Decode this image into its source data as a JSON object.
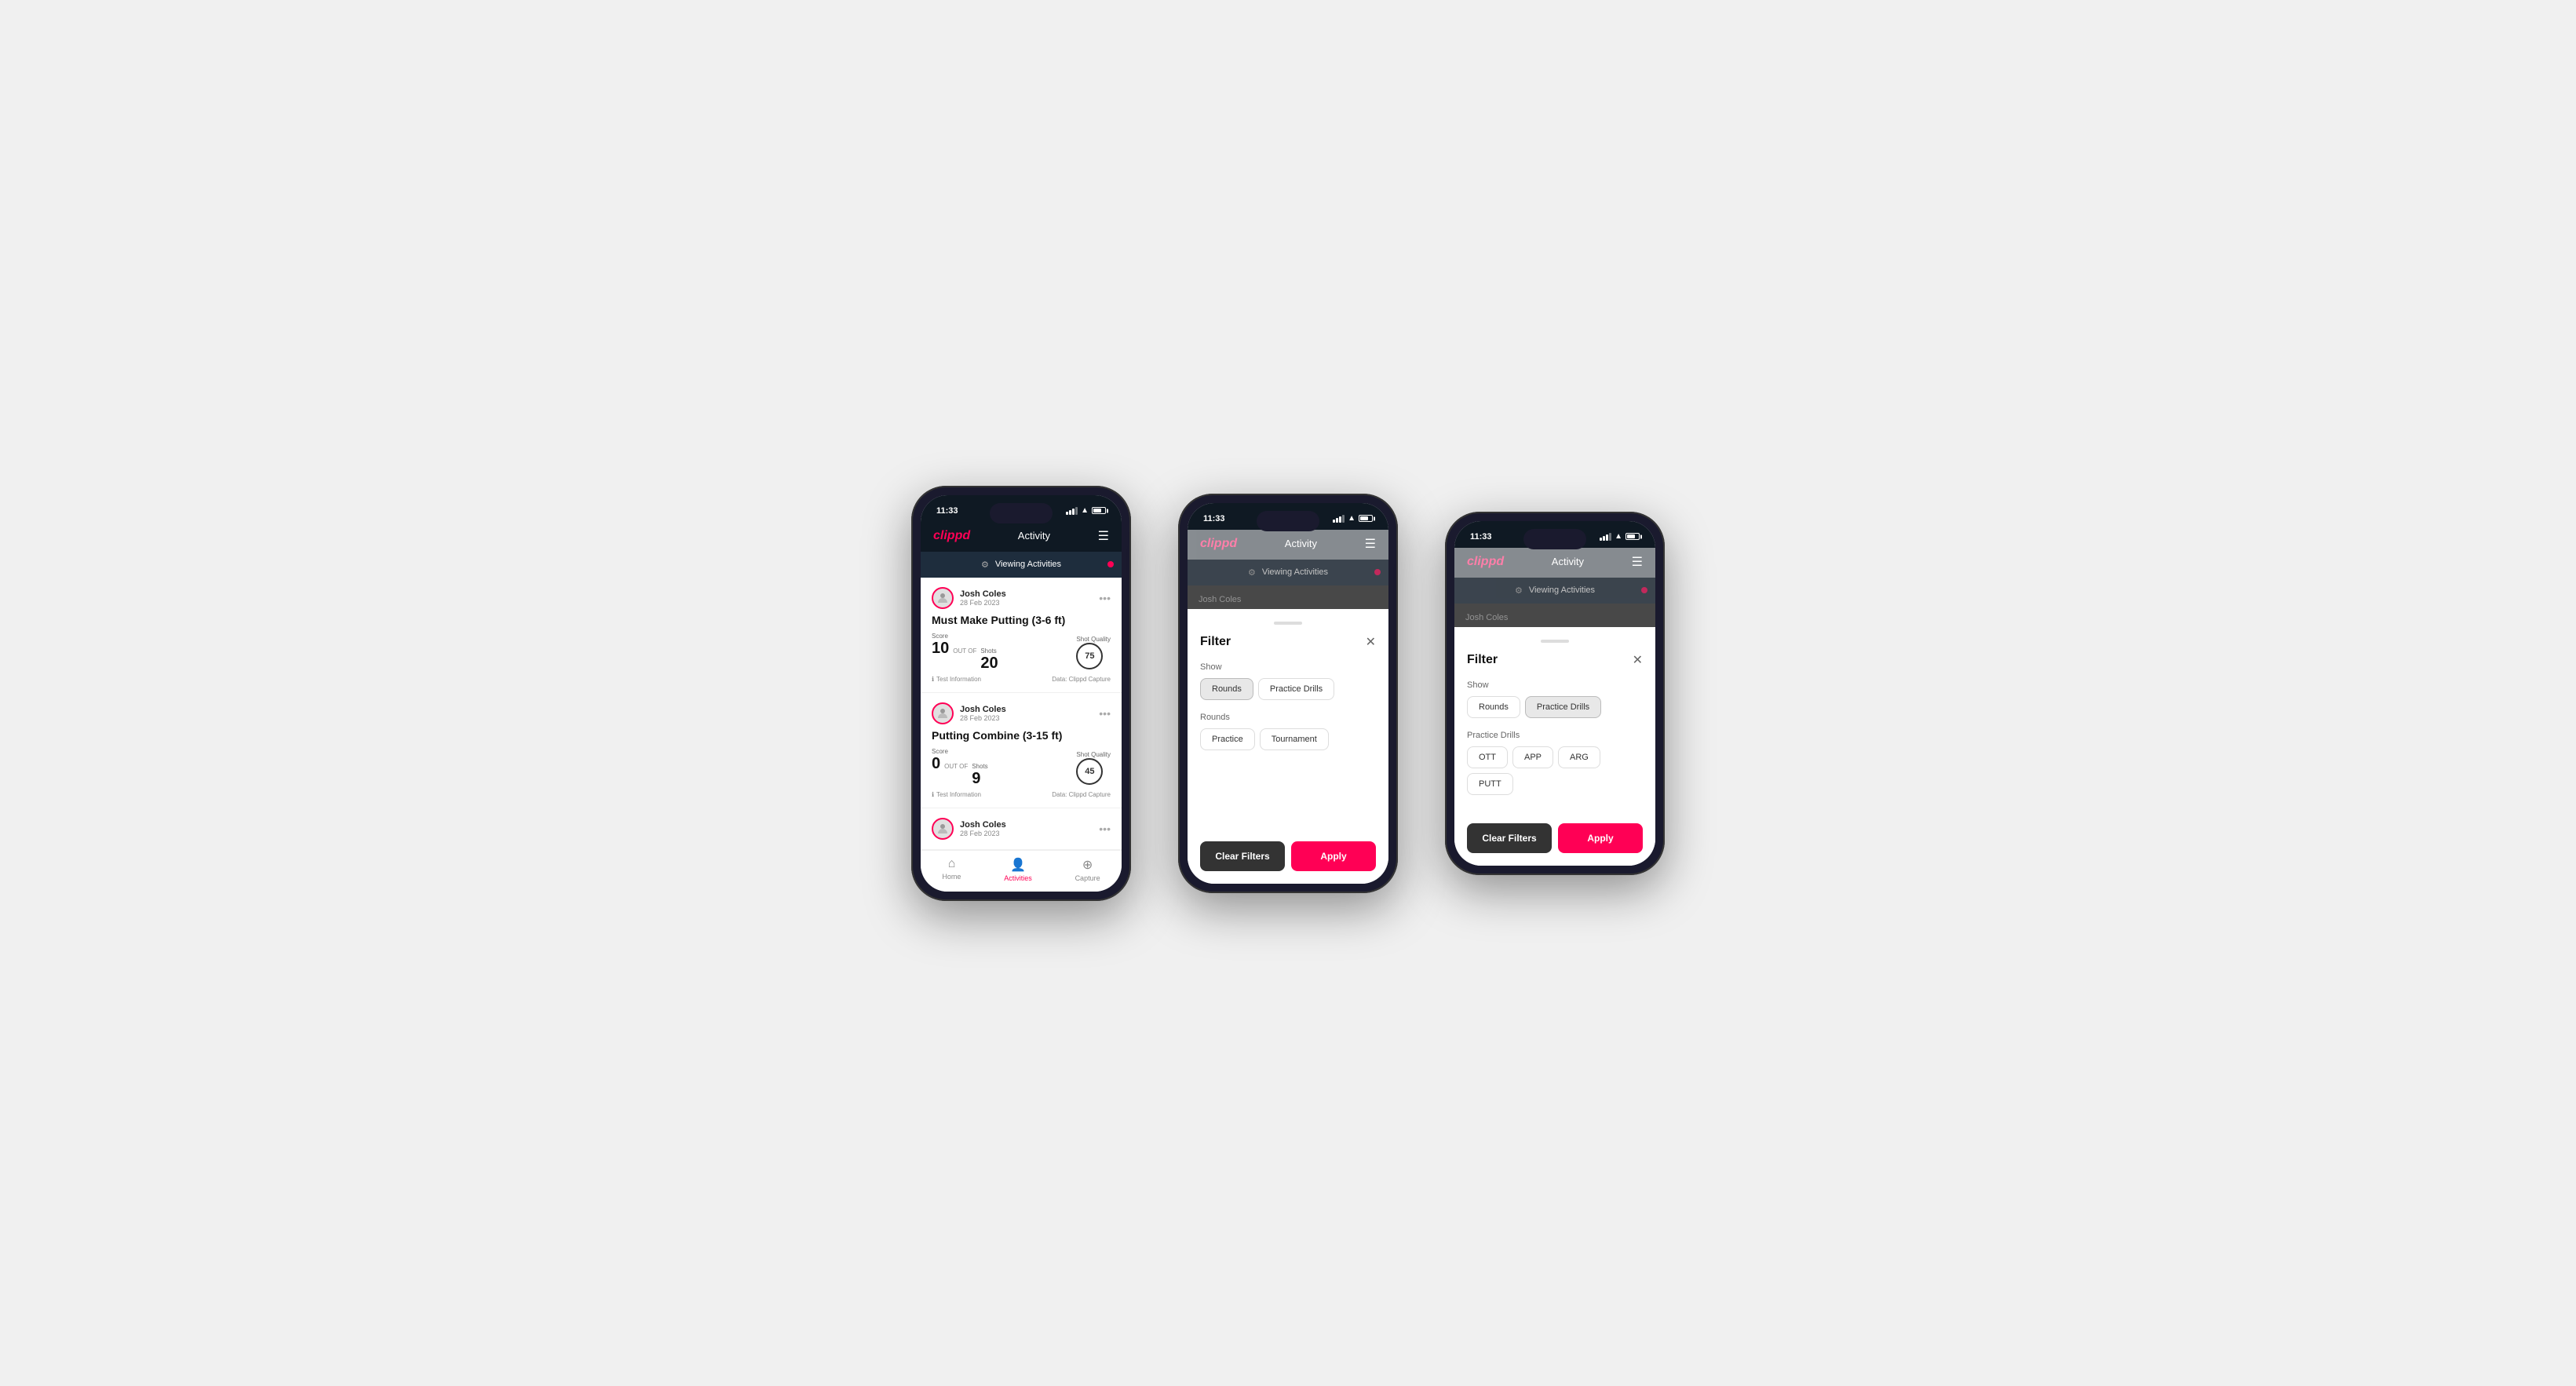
{
  "app": {
    "logo": "clippd",
    "header_title": "Activity",
    "time": "11:33"
  },
  "screen1": {
    "viewing_bar": "Viewing Activities",
    "cards": [
      {
        "user_name": "Josh Coles",
        "user_date": "28 Feb 2023",
        "title": "Must Make Putting (3-6 ft)",
        "score_label": "Score",
        "score": "10",
        "out_of": "OUT OF",
        "shots_label": "Shots",
        "shots": "20",
        "shot_quality_label": "Shot Quality",
        "shot_quality": "75",
        "test_info": "Test Information",
        "data_source": "Data: Clippd Capture"
      },
      {
        "user_name": "Josh Coles",
        "user_date": "28 Feb 2023",
        "title": "Putting Combine (3-15 ft)",
        "score_label": "Score",
        "score": "0",
        "out_of": "OUT OF",
        "shots_label": "Shots",
        "shots": "9",
        "shot_quality_label": "Shot Quality",
        "shot_quality": "45",
        "test_info": "Test Information",
        "data_source": "Data: Clippd Capture"
      },
      {
        "user_name": "Josh Coles",
        "user_date": "28 Feb 2023"
      }
    ],
    "nav": {
      "home": "Home",
      "activities": "Activities",
      "capture": "Capture"
    }
  },
  "screen2": {
    "filter_title": "Filter",
    "show_label": "Show",
    "rounds_btn": "Rounds",
    "practice_drills_btn": "Practice Drills",
    "rounds_section_label": "Rounds",
    "practice_btn": "Practice",
    "tournament_btn": "Tournament",
    "clear_filters": "Clear Filters",
    "apply": "Apply",
    "viewing_bar": "Viewing Activities"
  },
  "screen3": {
    "filter_title": "Filter",
    "show_label": "Show",
    "rounds_btn": "Rounds",
    "practice_drills_btn": "Practice Drills",
    "practice_drills_section_label": "Practice Drills",
    "ott_btn": "OTT",
    "app_btn": "APP",
    "arg_btn": "ARG",
    "putt_btn": "PUTT",
    "clear_filters": "Clear Filters",
    "apply": "Apply",
    "viewing_bar": "Viewing Activities"
  }
}
